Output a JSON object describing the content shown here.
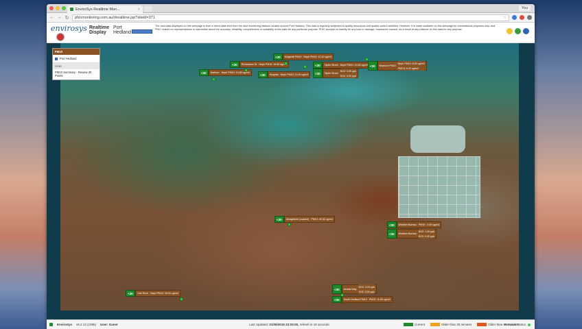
{
  "browser": {
    "tab_title": "EnviroSys Realtime Mon...",
    "user_label": "You",
    "url": "phicmonitoring.com.au/rtrealtime.jsp?siteid=371"
  },
  "header": {
    "logo_text": "envirosys",
    "title_line1": "Realtime",
    "title_line2": "Display",
    "site_line1": "Port",
    "site_line2": "Hedland",
    "disclaimer": "The dust data displayed on this webpage is from a direct data feed from the dust monitoring stations located around Port Hedland. This data is regularly subjected to quality assurance and quality control activities. However, it is made available on this webpage for informational purposes only, and PHIC makes no representations or warranties about the accuracy, reliability, completeness or suitability of this data for any particular purpose. PHIC accepts no liability for any loss or damage, howsoever caused, as a result of any reliance on this data for any purpose."
  },
  "sidepanel": {
    "header": "PM10",
    "site_item": "Port Hedland",
    "links_header": "Links",
    "link_item": "PM10 Summary - Review 30 Points"
  },
  "markers": [
    {
      "badge": "<30",
      "name": "Harbour",
      "reading": "Neph PM10: 10.80 ug/m3"
    },
    {
      "badge": "<30",
      "name": "Richardson St",
      "reading": "Neph PM10: 16.60 ug/m3"
    },
    {
      "badge": "<30",
      "name": "Kingsmill PM10",
      "reading": "Neph PM10: 12.40 ug/m3"
    },
    {
      "badge": "<30",
      "name": "Hospital",
      "reading": "Neph PM10: 11.00 ug/m3"
    },
    {
      "badge": "<30",
      "name": "Taplin Street",
      "reading": "Neph PM10: 10.80 ug/m3"
    },
    {
      "badge": "<30",
      "name": "Taplin Street",
      "reading": "NO2: 3.00 ppb",
      "reading2": "SO2: 0.00 ppb"
    },
    {
      "badge": "<30",
      "name": "Neptune PM10",
      "reading": "Neph PM10: 8.00 ug/m3",
      "reading2": "PM2.5: 6.20 ug/m3"
    },
    {
      "badge": "<30",
      "name": "Wedgefield (Lavidez)",
      "reading": "PM10: 30.30 ug/m3"
    },
    {
      "badge": "<30",
      "name": "Weather Bureau",
      "reading": "PM10: -0.30 ug/m3"
    },
    {
      "badge": "<30",
      "name": "Weather Bureau",
      "reading": "NO2: 1.00 ppb",
      "reading2": "SO2: 0.00 ppb"
    },
    {
      "badge": "<30",
      "name": "Yule River",
      "reading": "Neph PM10: 15.00 ug/m3"
    },
    {
      "badge": "<30",
      "name": "Acacia Way",
      "reading": "NO2: 3.00 ppb",
      "reading2": "SO2: 3.00 ppb"
    },
    {
      "badge": "<30",
      "name": "South Hedland PM10",
      "reading": "PM10: 11.00 ug/m3"
    }
  ],
  "statusbar": {
    "app": "EnviroSys",
    "version": "v6.2.13 (1095)",
    "user": "User: Guest",
    "last_updated_label": "Last Updated:",
    "last_updated_value": "21/05/2015 23:03:00,",
    "refresh_text": "refresh in 18 seconds",
    "legend": [
      {
        "label": "Current",
        "color": "#1b8a2a"
      },
      {
        "label": "Older than 30 minutes",
        "color": "#f0a11c"
      },
      {
        "label": "Older than 60 minutes",
        "color": "#e0551a"
      }
    ],
    "network_label": "Network Status:"
  }
}
